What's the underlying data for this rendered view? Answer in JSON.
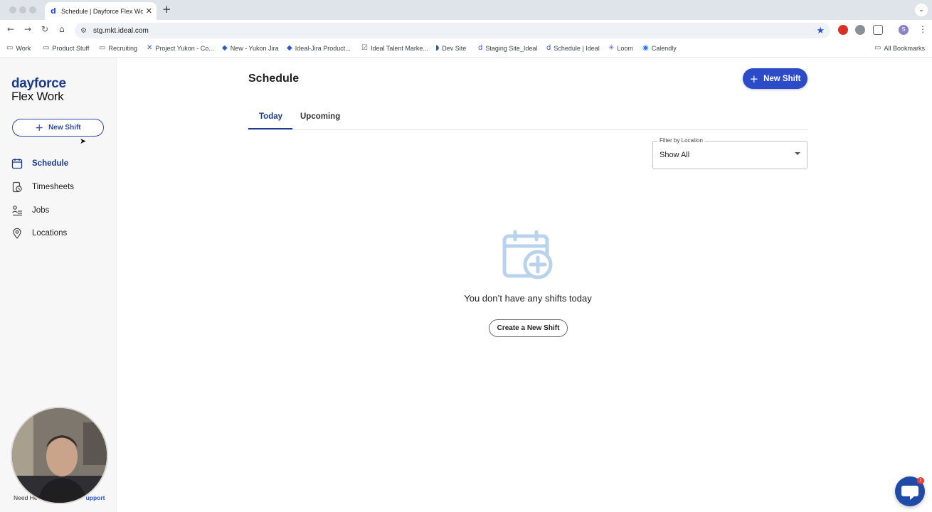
{
  "browser": {
    "tab_title": "Schedule | Dayforce Flex Wor",
    "tab_favicon": "d",
    "url": "stg.mkt.ideal.com",
    "profile_initial": "S",
    "bookmarks": [
      {
        "label": "Work",
        "icon": "folder-icon"
      },
      {
        "label": "Product Stuff",
        "icon": "folder-icon"
      },
      {
        "label": "Recruiting",
        "icon": "folder-icon"
      },
      {
        "label": "Project Yukon - Co...",
        "icon": "jira-icon"
      },
      {
        "label": "New - Yukon Jira",
        "icon": "jira-icon"
      },
      {
        "label": "Ideal-Jira Product...",
        "icon": "jira-icon"
      },
      {
        "label": "Ideal Talent Marke...",
        "icon": "checkbox-icon"
      },
      {
        "label": "Dev Site",
        "icon": "dev-icon"
      },
      {
        "label": "Staging Site_Ideal",
        "icon": "dayforce-icon"
      },
      {
        "label": "Schedule | Ideal",
        "icon": "dayforce-icon"
      },
      {
        "label": "Loom",
        "icon": "loom-icon"
      },
      {
        "label": "Calendly",
        "icon": "calendly-icon"
      }
    ],
    "all_bookmarks": "All Bookmarks"
  },
  "sidebar": {
    "logo_top": "dayforce",
    "logo_bottom": "Flex Work",
    "new_shift": "New Shift",
    "items": [
      {
        "label": "Schedule",
        "icon": "calendar-icon",
        "active": true
      },
      {
        "label": "Timesheets",
        "icon": "timesheet-icon",
        "active": false
      },
      {
        "label": "Jobs",
        "icon": "jobs-icon",
        "active": false
      },
      {
        "label": "Locations",
        "icon": "location-pin-icon",
        "active": false
      }
    ],
    "help_prefix": "Need He",
    "help_link": "upport"
  },
  "main": {
    "title": "Schedule",
    "new_shift": "New Shift",
    "tabs": [
      {
        "label": "Today",
        "active": true
      },
      {
        "label": "Upcoming",
        "active": false
      }
    ],
    "filter": {
      "label": "Filter by Location",
      "value": "Show All"
    },
    "empty_message": "You don’t have any shifts today",
    "create_button": "Create a New Shift"
  },
  "chat": {
    "badge": "1"
  },
  "colors": {
    "brand": "#1b3a8f",
    "primary_button": "#2b4bc8",
    "empty_icon": "#b9d3ef"
  }
}
